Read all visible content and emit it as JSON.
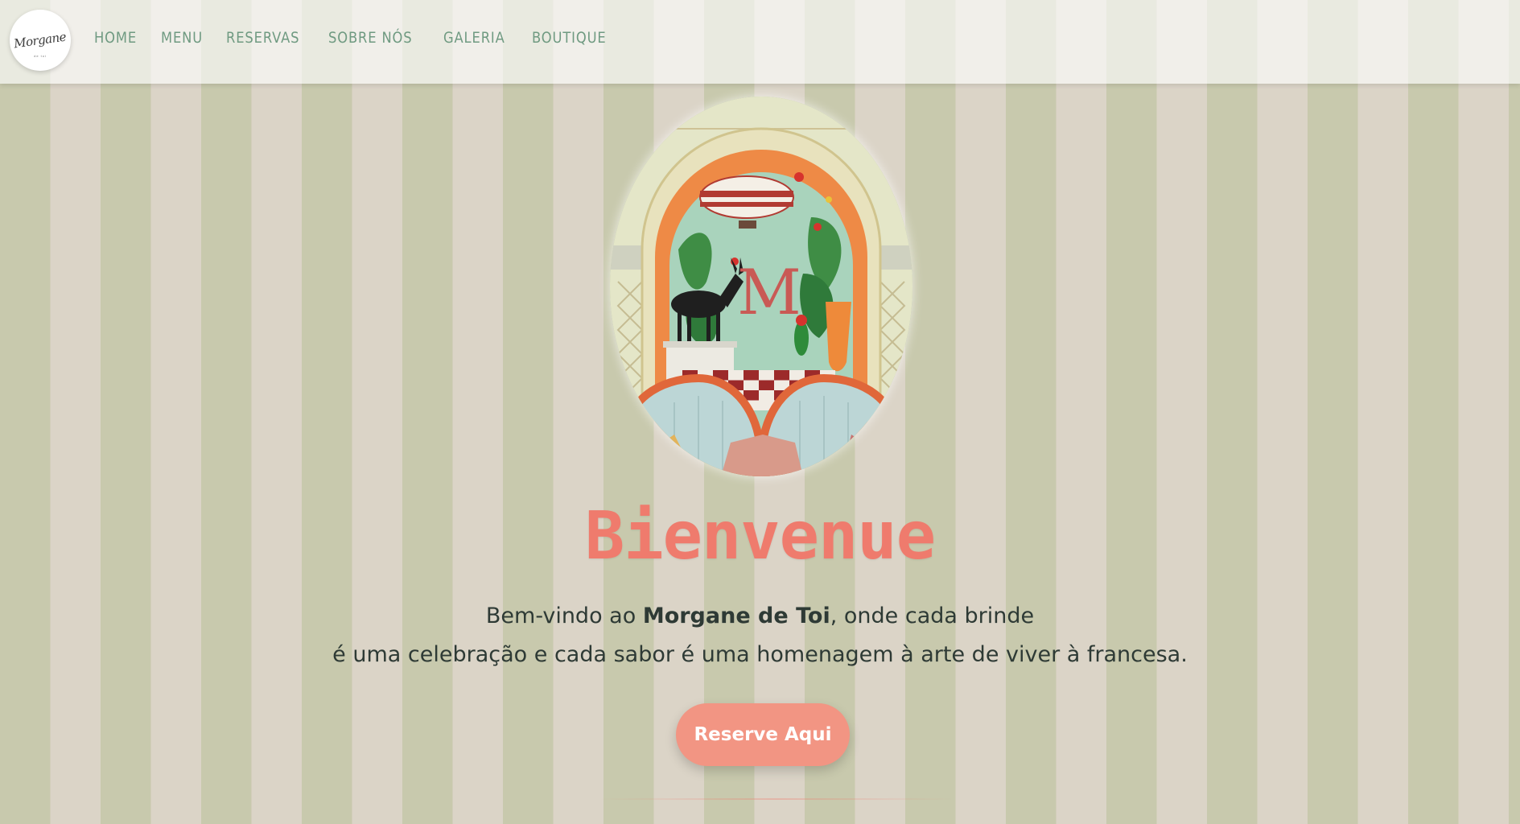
{
  "brand": {
    "logo_text": "Morgane",
    "logo_subtext": "de toi"
  },
  "nav": {
    "items": [
      {
        "label": "HOME"
      },
      {
        "label": "MENU"
      },
      {
        "label": "RESERVAS"
      },
      {
        "label": "SOBRE NÓS"
      },
      {
        "label": "GALERIA"
      },
      {
        "label": "BOUTIQUE"
      }
    ]
  },
  "hero": {
    "title": "Bienvenue",
    "intro_line1_prefix": "Bem-vindo ao ",
    "intro_line1_bold": "Morgane de Toi",
    "intro_line1_suffix": ", onde cada brinde",
    "intro_line2": "é uma celebração e cada sabor é uma homenagem à arte de viver à francesa.",
    "cta_label": "Reserve Aqui",
    "image_letter": "M"
  },
  "colors": {
    "stripe_green": "#c8c9ad",
    "stripe_beige": "#dbd4c7",
    "nav_text": "#6f9a81",
    "title_coral": "#ef7b6d",
    "cta_bg": "#f29583",
    "body_text": "#2e3a35"
  }
}
